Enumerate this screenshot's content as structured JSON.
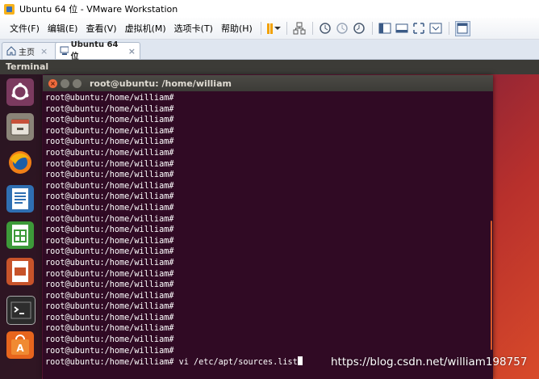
{
  "window": {
    "title": "Ubuntu 64 位 - VMware Workstation"
  },
  "menubar": {
    "items": [
      "文件(F)",
      "编辑(E)",
      "查看(V)",
      "虚拟机(M)",
      "选项卡(T)",
      "帮助(H)"
    ]
  },
  "tabs": [
    {
      "label": "主页",
      "icon": "home-icon"
    },
    {
      "label": "Ubuntu 64 位",
      "icon": "vm-icon"
    }
  ],
  "ubuntu": {
    "panel_title": "Terminal",
    "launcher": [
      "ubuntu-dash-icon",
      "files-icon",
      "firefox-icon",
      "writer-icon",
      "calc-icon",
      "impress-icon",
      "terminal-icon",
      "software-center-icon"
    ]
  },
  "terminal": {
    "title": "root@ubuntu: /home/william",
    "lines": [
      "root@ubuntu:/home/william#",
      "root@ubuntu:/home/william#",
      "root@ubuntu:/home/william#",
      "root@ubuntu:/home/william#",
      "root@ubuntu:/home/william#",
      "root@ubuntu:/home/william#",
      "root@ubuntu:/home/william#",
      "root@ubuntu:/home/william#",
      "root@ubuntu:/home/william#",
      "root@ubuntu:/home/william#",
      "root@ubuntu:/home/william#",
      "root@ubuntu:/home/william#",
      "root@ubuntu:/home/william#",
      "root@ubuntu:/home/william#",
      "root@ubuntu:/home/william#",
      "root@ubuntu:/home/william#",
      "root@ubuntu:/home/william#",
      "root@ubuntu:/home/william#",
      "root@ubuntu:/home/william#",
      "root@ubuntu:/home/william#",
      "root@ubuntu:/home/william#",
      "root@ubuntu:/home/william#",
      "root@ubuntu:/home/william#",
      "root@ubuntu:/home/william#"
    ],
    "current_command": "root@ubuntu:/home/william# vi /etc/apt/sources.list"
  },
  "watermark": "https://blog.csdn.net/william198757",
  "colors": {
    "terminal_bg": "#300a24",
    "ubuntu_orange": "#e95420",
    "panel": "#3c3b37"
  }
}
